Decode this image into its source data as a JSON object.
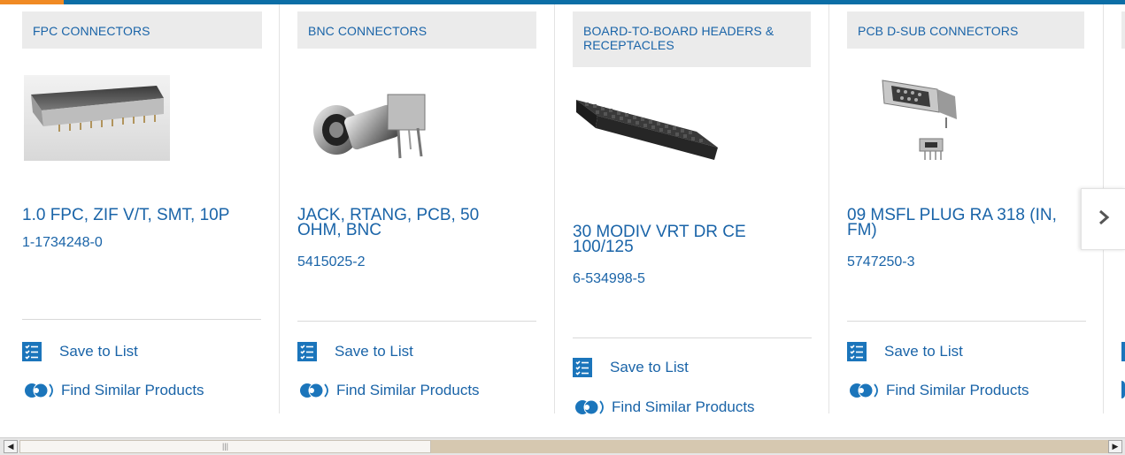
{
  "products": [
    {
      "category": "FPC CONNECTORS",
      "title": "1.0 FPC, ZIF V/T, SMT, 10P",
      "part_number": "1-1734248-0",
      "image_icon": "fpc-connector-image",
      "save_label": "Save to List",
      "similar_label": "Find Similar Products"
    },
    {
      "category": "BNC CONNECTORS",
      "title": "JACK, RTANG, PCB, 50 OHM, BNC",
      "part_number": "5415025-2",
      "image_icon": "bnc-connector-image",
      "save_label": "Save to List",
      "similar_label": "Find Similar Products"
    },
    {
      "category": "BOARD-TO-BOARD HEADERS & RECEPTACLES",
      "title": "30 MODIV VRT DR CE 100/125",
      "part_number": "6-534998-5",
      "image_icon": "header-receptacle-image",
      "save_label": "Save to List",
      "similar_label": "Find Similar Products"
    },
    {
      "category": "PCB D-SUB CONNECTORS",
      "title": "09 MSFL PLUG RA 318 (IN, FM)",
      "part_number": "5747250-3",
      "image_icon": "dsub-connector-image",
      "save_label": "Save to List",
      "similar_label": "Find Similar Products"
    }
  ],
  "navigation": {
    "next_icon": "chevron-right-icon"
  },
  "scrollbar": {
    "left_arrow": "◀",
    "right_arrow": "▶",
    "grip": "|||"
  },
  "colors": {
    "accent": "#f08a24",
    "brand": "#0c6ea6",
    "link": "#1a64a8",
    "icon_blue": "#1b75bb"
  }
}
